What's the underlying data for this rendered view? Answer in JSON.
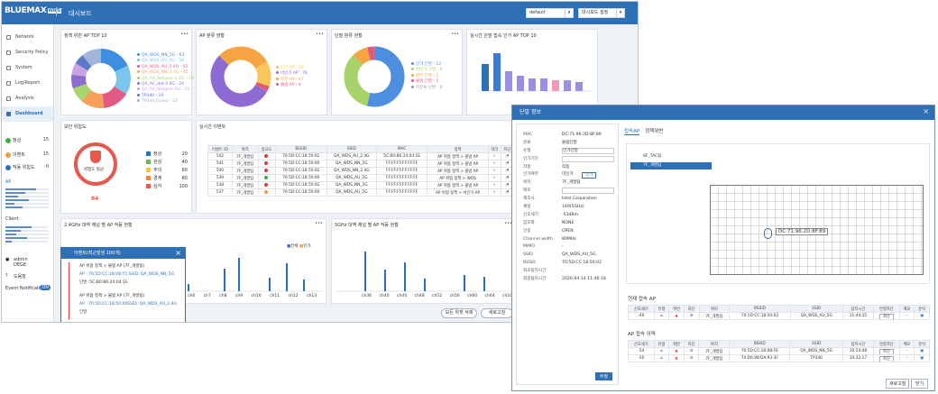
{
  "app": {
    "logo": "BLUEMAX",
    "logo_badge": "WIPS",
    "page_title": "대시보드",
    "profile": "default",
    "settings_btn": "대시보드 설정"
  },
  "sidebar": {
    "items": [
      {
        "label": "Network"
      },
      {
        "label": "Security Policy"
      },
      {
        "label": "System"
      },
      {
        "label": "Log/Report"
      },
      {
        "label": "Analysis"
      },
      {
        "label": "Dashboard"
      }
    ],
    "stats": [
      {
        "label": "정상",
        "value": "15",
        "color": "#3fae49"
      },
      {
        "label": "이벤트",
        "value": "15",
        "color": "#e6a23c"
      },
      {
        "label": "작동 위험도",
        "value": "0",
        "color": "#2f6fb5"
      }
    ],
    "ap_label": "AP",
    "client_label": "Client",
    "user": "admin",
    "user_org": "DEGE",
    "help": "도움말",
    "event_notif": "Event Notification",
    "event_notif_state": "ON"
  },
  "panels": {
    "p1": {
      "title": "정책 위반 AP TOP 10",
      "legend": [
        "QA_WDS_NN_5G - 63",
        "QA_WDS_AU_5G - 56",
        "QA_WDS_AU_2.4G - 52",
        "QA_WDS_NN_2.4G - 45",
        "QA_AX_Netgear-2.4G - 29",
        "QA_AC_dot-2.4G - 26",
        "QA_AX_Netgear-5G - 22",
        "TP340 - 19",
        "TP340_Guest - 18"
      ]
    },
    "p2": {
      "title": "AP 분류 현황",
      "legend": [
        "인가 AP : 20",
        "비인가 AP : 78",
        "외부 AP : 43",
        "불법 AP : 4"
      ]
    },
    "p3": {
      "title": "단말 분류 현황",
      "legend": [
        "인가 단말 : 12",
        "비인가 단말 : 8",
        "외부 단말 : 2",
        "불법 단말 : 1",
        "미분류 단말 : 0"
      ]
    },
    "p4": {
      "title": "실시간 단말 접속 인가 AP TOP 10"
    },
    "p5": {
      "title": "보안 위험도",
      "risk_label": "위험도 평균",
      "risk_value": "84",
      "levels": [
        {
          "label": "정상",
          "value": "20"
        },
        {
          "label": "관심",
          "value": "40"
        },
        {
          "label": "주의",
          "value": "60"
        },
        {
          "label": "경계",
          "value": "80"
        },
        {
          "label": "심각",
          "value": "100"
        }
      ]
    },
    "p6": {
      "title": "실시간 이벤트",
      "columns": [
        "이벤트 ID",
        "위치",
        "중요도",
        "BSSID",
        "SSID",
        "MAC",
        "정책",
        "처리",
        "차단"
      ],
      "rows": [
        [
          "542",
          "7F_개발팀",
          "70:5D:CC:18:50:02",
          "QA_WDS_AU_2.4G",
          "5C:B0:B6:24:04:1E",
          "AP 위협 정책 > 불법 AP"
        ],
        [
          "541",
          "7F_개발팀",
          "70:5D:CC:18:50:00",
          "QA_WDS_NN_5G",
          "FF:FF:FF:FF:FF:FF",
          "AP 위협 정책 > 불법 AP"
        ],
        [
          "540",
          "7F_개발팀",
          "70:5D:CC:18:50:02",
          "QA_WDS_NN_2.4G",
          "FF:FF:FF:FF:FF:FF",
          "AP 위협 정책 > 불법 AP"
        ],
        [
          "539",
          "7F_개발팀",
          "70:5D:CC:18:50:00",
          "QA_WDS_AU_5G",
          "FF:FF:FF:FF:FF:FF",
          "AP 위협 정책 > WDS"
        ],
        [
          "538",
          "7F_개발팀",
          "70:5D:CC:18:50:02",
          "QA_WDS_NN_5G",
          "FF:FF:FF:FF:FF:FF",
          "AP 위협 정책 > 불법 AP"
        ],
        [
          "537",
          "7F_개발팀",
          "70:5D:CC:18:50:00",
          "QA_WDS_AU_5G",
          "FF:FF:FF:FF:FF:FF",
          "AP 위협 정책 > 비인가 AP"
        ]
      ]
    },
    "p7": {
      "title": "2.4GHz 대역 채널 별 AP 작동 현황",
      "legend": [
        "전체",
        "인가"
      ],
      "xticks": [
        "ch6",
        "ch7",
        "ch8",
        "ch9",
        "ch10",
        "ch11",
        "ch12",
        "ch13"
      ]
    },
    "p8": {
      "title": "5GHz 대역 채널 별 AP 작동 현황",
      "xticks": [
        "ch36",
        "ch40",
        "ch44",
        "ch48",
        "ch52",
        "ch56",
        "ch60",
        "ch64",
        "ch100"
      ]
    }
  },
  "footer": {
    "delete_all": "모든 위젯 삭제",
    "refresh": "새로고침"
  },
  "recent": {
    "title": "이벤트(최근발생 100개)",
    "events": [
      {
        "line1": "AP 위협 정책 > 불법 AP (7F_개발팀)",
        "line2": "AP : 70:5D:CC:18:08:F5 SSID: QA_WDS_NN_5G",
        "line3": "단말 :5C:B0:B6:24:04:1E"
      },
      {
        "line1": "AP 위협 정책 > 불법 AP (7F_개발팀)",
        "line2": "AP : 70:5D:CC:18:50:00SSID: QA_WDS_AU_2.4G",
        "line3": "단말"
      }
    ]
  },
  "popup": {
    "title": "단말 정보",
    "fields": [
      [
        "MAC",
        "DC:71:96:2D:8F:89"
      ],
      [
        "분류",
        "불법단말"
      ],
      [
        "유형",
        "인가단말"
      ],
      [
        "인가기간",
        ""
      ],
      [
        "작동",
        "작동"
      ],
      [
        "인가여부",
        "미인가"
      ],
      [
        "위치",
        "7F_개발팀"
      ],
      [
        "메모",
        ""
      ],
      [
        "제조사",
        "Intel Corporation"
      ],
      [
        "채널",
        "149(5GHz)"
      ],
      [
        "신호세기",
        "-53dBm"
      ],
      [
        "암호화",
        "NONE"
      ],
      [
        "인증",
        "OPEN"
      ],
      [
        "Channel width",
        "80MHz"
      ],
      [
        "MIMO",
        "-"
      ],
      [
        "SSID",
        "QA_WDS_AU_5G"
      ],
      [
        "BSSID",
        "70:5D:CC:18:50:02"
      ],
      [
        "최초탐지시간",
        "-"
      ],
      [
        "최종탐지시간",
        "2020-04-14 11:46:18"
      ]
    ],
    "auth_btn": "인가",
    "edit_btn": "수정",
    "tabs": [
      "접속AP",
      "정책위반"
    ],
    "floors": [
      "6F_TAC팀",
      "7F_개발팀"
    ],
    "map_label": "DC:71:96:2D:8F:89",
    "current_title": "현재 접속 AP",
    "history_title": "AP 접속 이력",
    "cols": [
      "신호세기",
      "유형",
      "위반",
      "차단",
      "위치",
      "BSSID",
      "SSID",
      "탐지시간",
      "연결차단",
      "메모",
      "분석"
    ],
    "current": [
      {
        "signal": "-40",
        "loc": "7F_개발팀",
        "bssid": "70:5D:CC:18:50:02",
        "ssid": "QA_WDS_AU_5G",
        "time": "11:44:35",
        "btn": "차단"
      }
    ],
    "history": [
      {
        "signal": "-54",
        "loc": "7F_개발팀",
        "bssid": "70:5D:CC:18:08:FE",
        "ssid": "QA_WDS_NN_5G",
        "time": "10:24:48",
        "btn": "차단"
      },
      {
        "signal": "-50",
        "loc": "7F_개발팀",
        "bssid": "74:DA:88:DA:93:3F",
        "ssid": "TP340",
        "time": "10:32:17",
        "btn": "차단"
      }
    ],
    "refresh": "새로고침",
    "close": "닫기"
  },
  "colors": {
    "accent": "#2f6fb5"
  }
}
